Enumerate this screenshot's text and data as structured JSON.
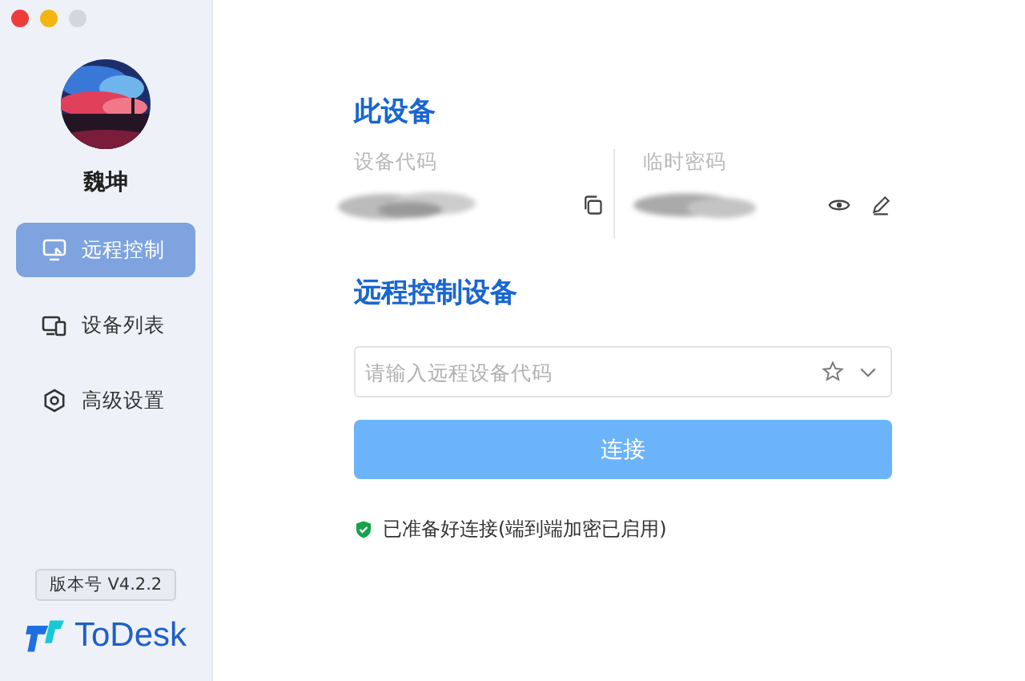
{
  "user": {
    "name": "魏坤"
  },
  "sidebar": {
    "items": [
      {
        "label": "远程控制",
        "kind": "remote",
        "selected": true
      },
      {
        "label": "设备列表",
        "kind": "devices",
        "selected": false
      },
      {
        "label": "高级设置",
        "kind": "settings",
        "selected": false
      }
    ]
  },
  "version": "版本号 V4.2.2",
  "logo": "ToDesk",
  "this_device": {
    "title": "此设备",
    "code_label": "设备代码",
    "password_label": "临时密码"
  },
  "remote": {
    "title": "远程控制设备",
    "placeholder": "请输入远程设备代码",
    "button": "连接"
  },
  "status": {
    "text": "已准备好连接(端到端加密已启用)"
  }
}
